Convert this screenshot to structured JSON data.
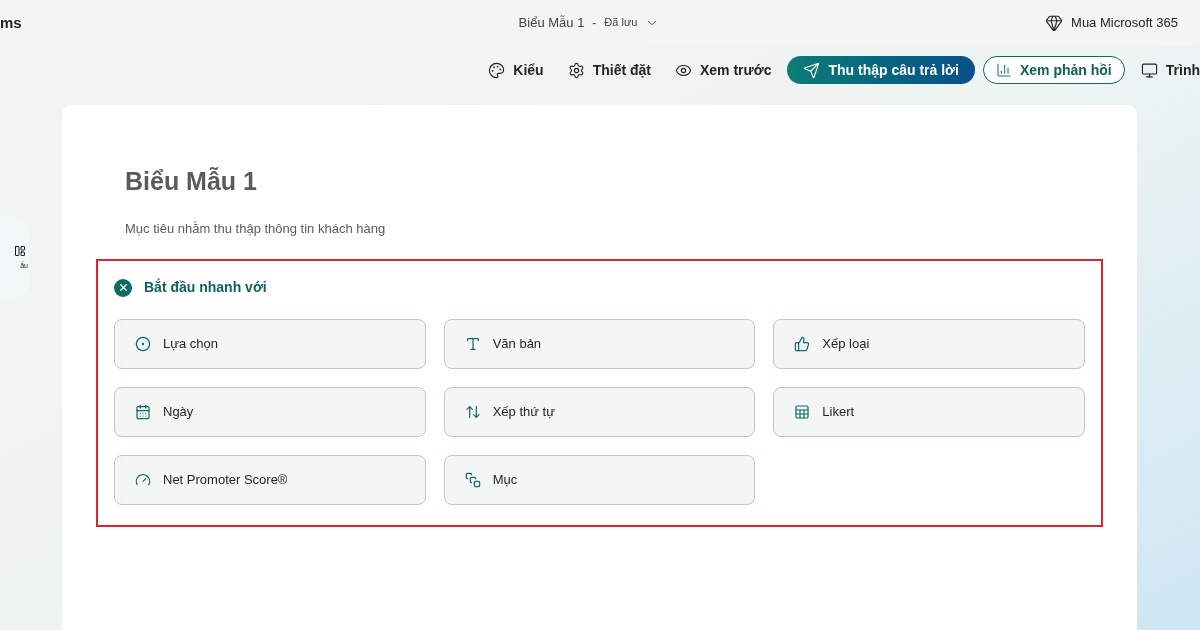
{
  "app_name": "ms",
  "document": {
    "title": "Biểu Mẫu 1",
    "separator": "-",
    "status": "Đã lưu"
  },
  "upgrade": "Mua Microsoft 365",
  "toolbar": [
    {
      "kind": "style",
      "label": "Kiểu"
    },
    {
      "kind": "settings",
      "label": "Thiết đặt"
    },
    {
      "kind": "preview",
      "label": "Xem trước"
    },
    {
      "kind": "collect",
      "label": "Thu thập câu trả lời"
    },
    {
      "kind": "responses",
      "label": "Xem phản hồi"
    },
    {
      "kind": "present",
      "label": "Trình"
    }
  ],
  "side_panel": {
    "label": "ẫu"
  },
  "form": {
    "title": "Biểu Mẫu 1",
    "description": "Mục tiêu nhằm thu thập thông tin khách hàng"
  },
  "quick_start": {
    "title": "Bắt đầu nhanh với",
    "options": [
      {
        "kind": "choice",
        "label": "Lựa chọn"
      },
      {
        "kind": "text",
        "label": "Văn bản"
      },
      {
        "kind": "rating",
        "label": "Xếp loại"
      },
      {
        "kind": "date",
        "label": "Ngày"
      },
      {
        "kind": "ranking",
        "label": "Xếp thứ tự"
      },
      {
        "kind": "likert",
        "label": "Likert"
      },
      {
        "kind": "nps",
        "label": "Net Promoter Score®"
      },
      {
        "kind": "section",
        "label": "Mục"
      }
    ]
  }
}
